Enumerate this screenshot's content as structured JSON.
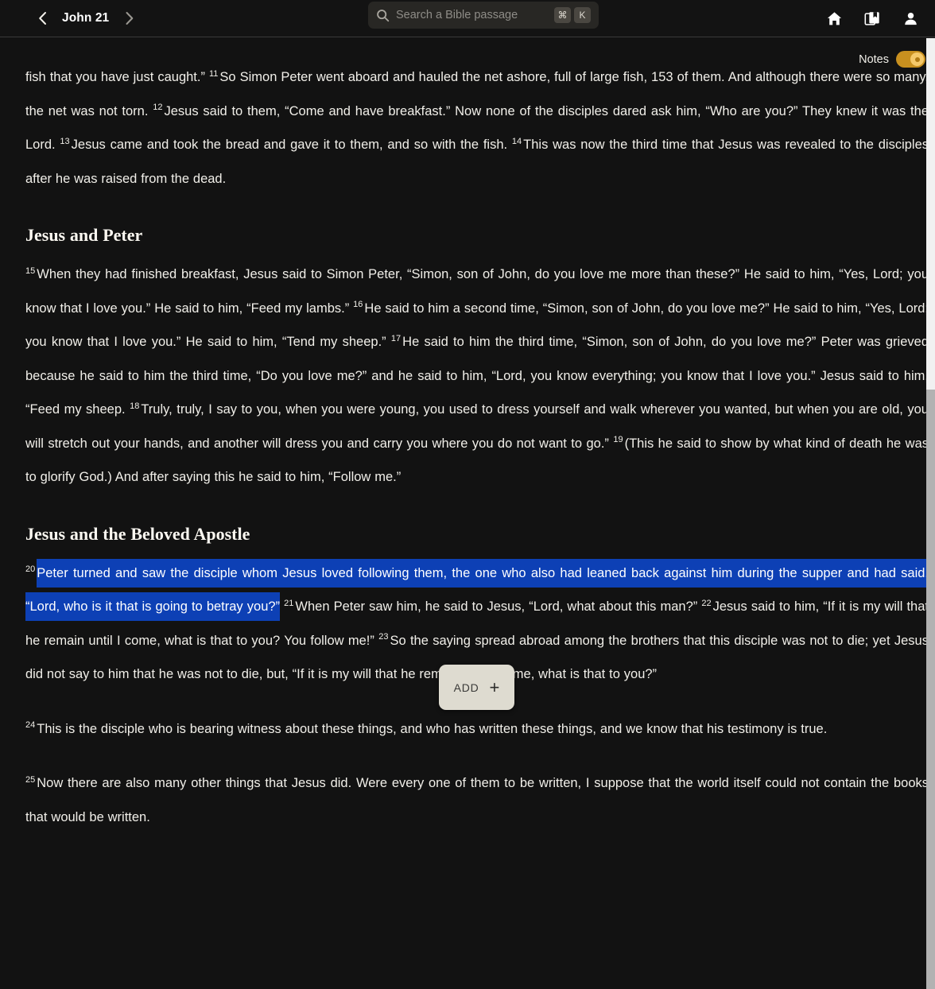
{
  "topbar": {
    "prev_icon": "chevron-left-icon",
    "next_icon": "chevron-right-icon",
    "chapter": "John 21",
    "search": {
      "icon": "search-icon",
      "placeholder": "Search a Bible passage",
      "shortcut_mod": "⌘",
      "shortcut_key": "K"
    },
    "icons": [
      {
        "name": "home-icon",
        "label": "Home"
      },
      {
        "name": "library-icon",
        "label": "Library"
      },
      {
        "name": "account-icon",
        "label": "Account"
      }
    ]
  },
  "notes": {
    "label": "Notes",
    "enabled": true,
    "accent_color": "#c8901f"
  },
  "selection": {
    "highlight_color": "#0d40b5"
  },
  "add_button": {
    "label": "ADD",
    "plus": "+",
    "background_color": "#dedbd0"
  },
  "passage": {
    "p1_continue": "fish that you have just caught.”",
    "v11_num": "11",
    "v11": "So Simon Peter went aboard and hauled the net ashore, full of large fish, 153 of them. And although there were so many, the net was not torn.",
    "v12_num": "12",
    "v12": "Jesus said to them, “Come and have breakfast.” Now none of the disciples dared ask him, “Who are you?” They knew it was the Lord.",
    "v13_num": "13",
    "v13": "Jesus came and took the bread and gave it to them, and so with the fish.",
    "v14_num": "14",
    "v14": "This was now the third time that Jesus was revealed to the disciples after he was raised from the dead.",
    "heading1": "Jesus and Peter",
    "v15_num": "15",
    "v15": "When they had finished breakfast, Jesus said to Simon Peter, “Simon, son of John, do you love me more than these?” He said to him, “Yes, Lord; you know that I love you.” He said to him, “Feed my lambs.”",
    "v16_num": "16",
    "v16": "He said to him a second time, “Simon, son of John, do you love me?” He said to him, “Yes, Lord; you know that I love you.” He said to him, “Tend my sheep.”",
    "v17_num": "17",
    "v17": "He said to him the third time, “Simon, son of John, do you love me?” Peter was grieved because he said to him the third time, “Do you love me?” and he said to him, “Lord, you know everything; you know that I love you.” Jesus said to him, “Feed my sheep.",
    "v18_num": "18",
    "v18": "Truly, truly, I say to you, when you were young, you used to dress yourself and walk wherever you wanted, but when you are old, you will stretch out your hands, and another will dress you and carry you where you do not want to go.”",
    "v19_num": "19",
    "v19": "(This he said to show by what kind of death he was to glorify God.) And after saying this he said to him, “Follow me.”",
    "heading2": "Jesus and the Beloved Apostle",
    "v20_num": "20",
    "v20_selected": "Peter turned and saw the disciple whom Jesus loved following them, the one who also had leaned back against him during the supper and had said, “Lord, who is it that is going to betray you?”",
    "v21_num": "21",
    "v21": "When Peter saw him, he said to Jesus, “Lord, what about this man?”",
    "v22_num": "22",
    "v22": "Jesus said to him, “If it is my will that he remain until I come, what is that to you? You follow me!”",
    "v23_num": "23",
    "v23": "So the saying spread abroad among the brothers that this disciple was not to die; yet Jesus did not say to him that he was not to die, but, “If it is my will that he remain until I come, what is that to you?”",
    "v24_num": "24",
    "v24": "This is the disciple who is bearing witness about these things, and who has written these things, and we know that his testimony is true.",
    "v25_num": "25",
    "v25": "Now there are also many other things that Jesus did. Were every one of them to be written, I suppose that the world itself could not contain the books that would be written."
  }
}
